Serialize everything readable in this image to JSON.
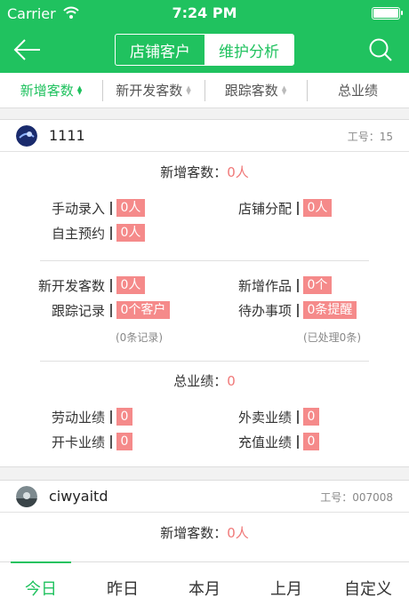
{
  "status_bar": {
    "carrier": "Carrier",
    "time": "7:24 PM"
  },
  "nav": {
    "segments": [
      "店铺客户",
      "维护分析"
    ],
    "active_segment": 1
  },
  "filters": [
    {
      "label": "新增客数",
      "active": true
    },
    {
      "label": "新开发客数",
      "active": false
    },
    {
      "label": "跟踪客数",
      "active": false
    },
    {
      "label": "总业绩",
      "active": false
    }
  ],
  "cards": [
    {
      "name": "1111",
      "id_label": "工号：15",
      "new_customers_label": "新增客数：",
      "new_customers_value": "0人",
      "manual_entry_label": "手动录入",
      "manual_entry_value": "0人",
      "store_assign_label": "店铺分配",
      "store_assign_value": "0人",
      "self_booking_label": "自主预约",
      "self_booking_value": "0人",
      "new_dev_label": "新开发客数",
      "new_dev_value": "0人",
      "new_works_label": "新增作品",
      "new_works_value": "0个",
      "tracking_label": "跟踪记录",
      "tracking_value": "0个客户",
      "tracking_sub": "(0条记录)",
      "todo_label": "待办事项",
      "todo_value": "0条提醒",
      "todo_sub": "(已处理0条)",
      "total_label": "总业绩：",
      "total_value": "0",
      "labor_label": "劳动业绩",
      "labor_value": "0",
      "takeout_label": "外卖业绩",
      "takeout_value": "0",
      "card_open_label": "开卡业绩",
      "card_open_value": "0",
      "recharge_label": "充值业绩",
      "recharge_value": "0"
    },
    {
      "name": "ciwyaitd",
      "id_label": "工号：007008",
      "new_customers_label": "新增客数：",
      "new_customers_value": "0人"
    }
  ],
  "tabs": [
    "今日",
    "昨日",
    "本月",
    "上月",
    "自定义"
  ],
  "active_tab": 0,
  "colors": {
    "brand_green": "#20c25f",
    "value_red": "#f58a8a"
  }
}
